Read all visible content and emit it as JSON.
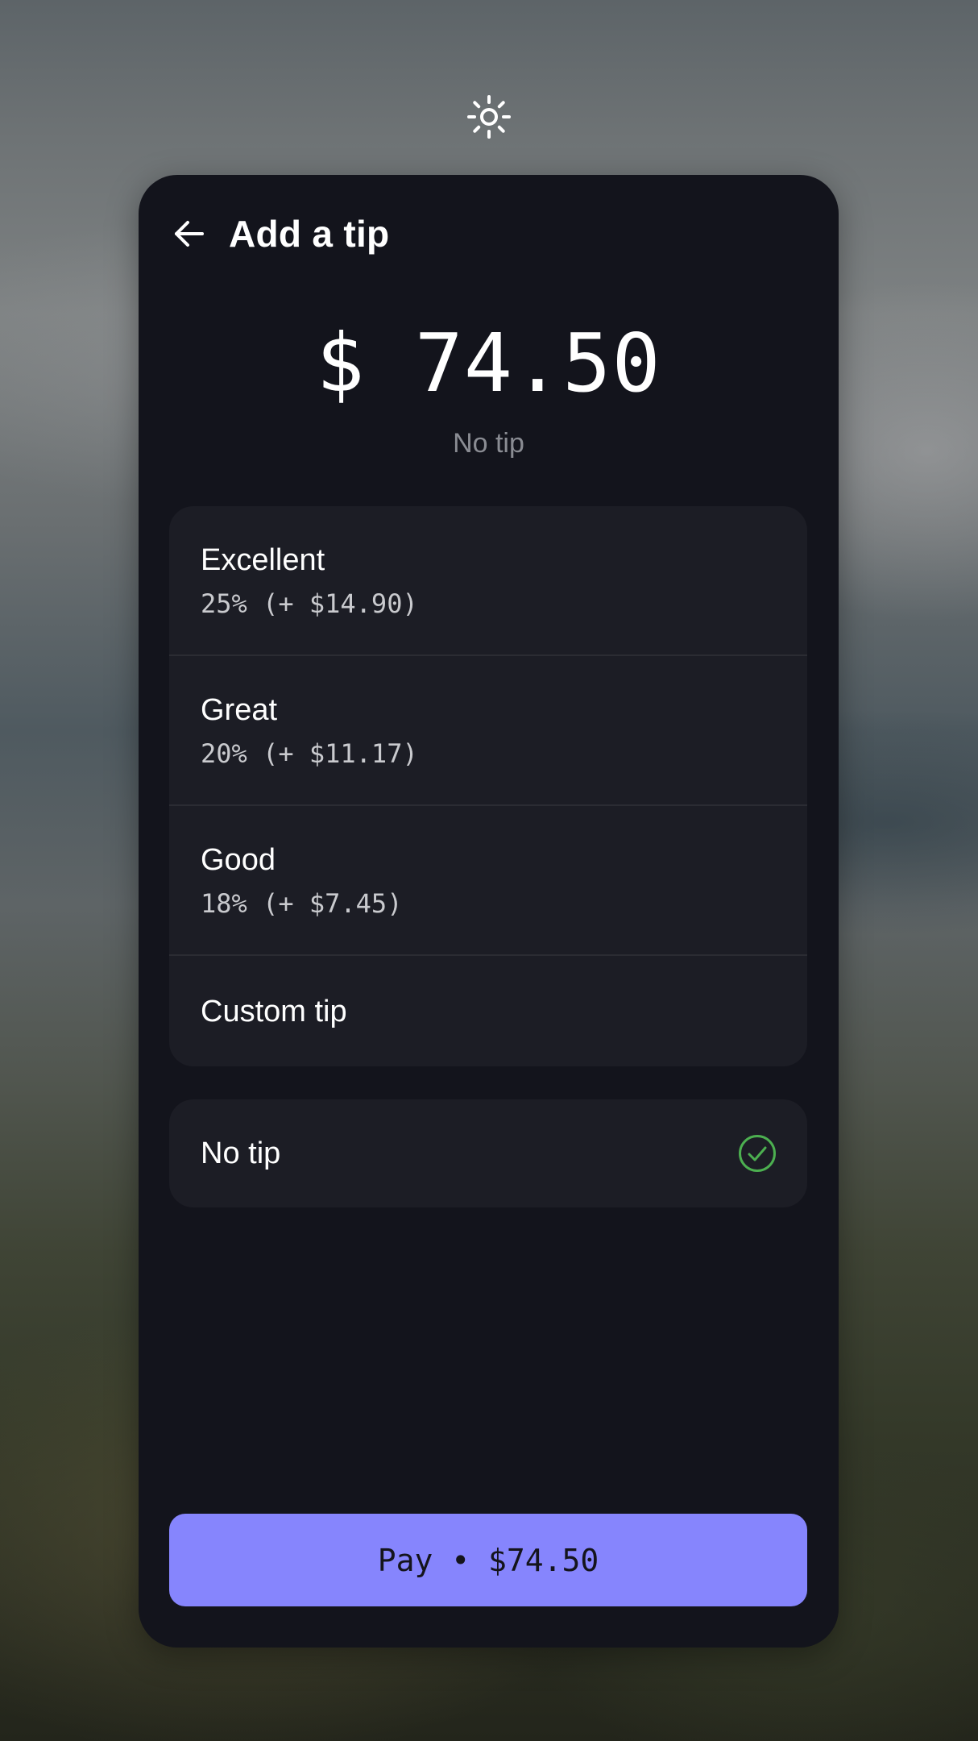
{
  "header": {
    "title": "Add a tip"
  },
  "summary": {
    "amount": "$ 74.50",
    "status": "No tip"
  },
  "tip_options": [
    {
      "label": "Excellent",
      "detail": "25% (+ $14.90)"
    },
    {
      "label": "Great",
      "detail": "20% (+ $11.17)"
    },
    {
      "label": "Good",
      "detail": "18% (+ $7.45)"
    }
  ],
  "custom_tip": {
    "label": "Custom tip"
  },
  "no_tip": {
    "label": "No tip",
    "selected": true
  },
  "pay_button": {
    "label": "Pay • $74.50"
  },
  "colors": {
    "sheet_background": "#13141c",
    "card_background": "#1c1d25",
    "accent": "#8685fd",
    "check": "#4caf50",
    "muted_text": "#8a8c93"
  },
  "icons": {
    "theme_toggle": "sun-icon",
    "back": "arrow-left-icon",
    "selected": "check-circle-icon"
  }
}
